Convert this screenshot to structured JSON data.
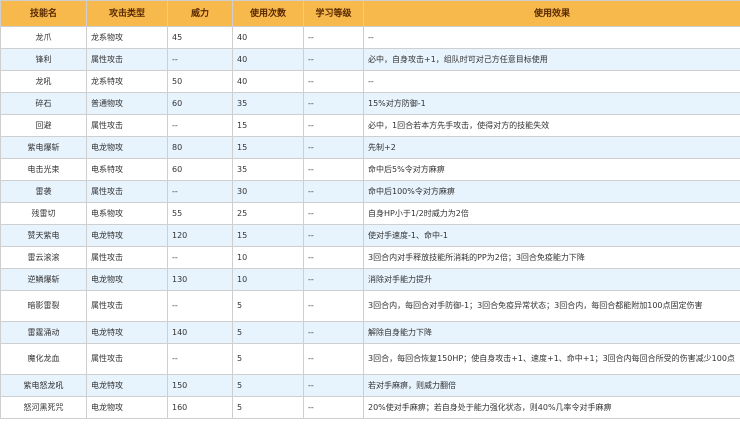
{
  "table": {
    "headers": [
      "技能名",
      "攻击类型",
      "威力",
      "使用次数",
      "学习等级",
      "使用效果"
    ],
    "rows": [
      {
        "name": "龙爪",
        "type": "龙系物攻",
        "power": "45",
        "uses": "40",
        "level": "--",
        "effect": "--"
      },
      {
        "name": "锋利",
        "type": "属性攻击",
        "power": "--",
        "uses": "40",
        "level": "--",
        "effect": "必中，自身攻击+1，组队时可对己方任意目标使用"
      },
      {
        "name": "龙吼",
        "type": "龙系特攻",
        "power": "50",
        "uses": "40",
        "level": "--",
        "effect": "--"
      },
      {
        "name": "碎石",
        "type": "普通物攻",
        "power": "60",
        "uses": "35",
        "level": "--",
        "effect": "15%对方防御-1"
      },
      {
        "name": "回避",
        "type": "属性攻击",
        "power": "--",
        "uses": "15",
        "level": "--",
        "effect": "必中，1回合若本方先手攻击，使得对方的技能失效"
      },
      {
        "name": "紫电爆斩",
        "type": "电龙物攻",
        "power": "80",
        "uses": "15",
        "level": "--",
        "effect": "先制+2"
      },
      {
        "name": "电击光束",
        "type": "电系特攻",
        "power": "60",
        "uses": "35",
        "level": "--",
        "effect": "命中后5%令对方麻痹"
      },
      {
        "name": "雷袭",
        "type": "属性攻击",
        "power": "--",
        "uses": "30",
        "level": "--",
        "effect": "命中后100%令对方麻痹"
      },
      {
        "name": "残雷切",
        "type": "电系物攻",
        "power": "55",
        "uses": "25",
        "level": "--",
        "effect": "自身HP小于1/2时威力为2倍"
      },
      {
        "name": "赞天紫电",
        "type": "电龙特攻",
        "power": "120",
        "uses": "15",
        "level": "--",
        "effect": "使对手速度-1、命中-1"
      },
      {
        "name": "雷云滚滚",
        "type": "属性攻击",
        "power": "--",
        "uses": "10",
        "level": "--",
        "effect": "3回合内对手释放技能所消耗的PP为2倍；3回合免疫能力下降"
      },
      {
        "name": "逆鳞爆斩",
        "type": "电龙物攻",
        "power": "130",
        "uses": "10",
        "level": "--",
        "effect": "消除对手能力提升"
      },
      {
        "name": "暗影雷裂",
        "type": "属性攻击",
        "power": "--",
        "uses": "5",
        "level": "--",
        "effect": "3回合内，每回合对手防御-1；3回合免疫异常状态；3回合内，每回合都能附加100点固定伤害",
        "tall": true
      },
      {
        "name": "雷霆涌动",
        "type": "电龙特攻",
        "power": "140",
        "uses": "5",
        "level": "--",
        "effect": "解除自身能力下降"
      },
      {
        "name": "魔化龙血",
        "type": "属性攻击",
        "power": "--",
        "uses": "5",
        "level": "--",
        "effect": "3回合，每回合恢复150HP；使自身攻击+1、速度+1、命中+1；3回合内每回合所受的伤害减少100点",
        "tall": true
      },
      {
        "name": "紫电怒龙吼",
        "type": "电龙特攻",
        "power": "150",
        "uses": "5",
        "level": "--",
        "effect": "若对手麻痹，则威力翻倍"
      },
      {
        "name": "怒河黑死咒",
        "type": "电龙物攻",
        "power": "160",
        "uses": "5",
        "level": "--",
        "effect": "20%使对手麻痹；若自身处于能力强化状态，则40%几率令对手麻痹"
      }
    ]
  }
}
